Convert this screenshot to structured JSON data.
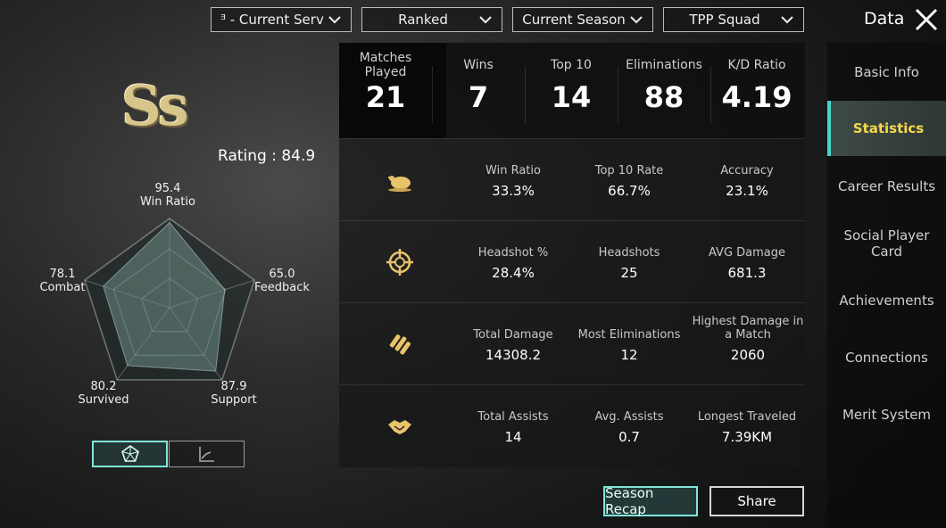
{
  "header": {
    "title": "Data",
    "filters": {
      "server": "ᴲ - Current Server",
      "mode": "Ranked",
      "season": "Current Season",
      "squad": "TPP Squad"
    }
  },
  "sidebar": {
    "items": [
      {
        "label": "Basic Info"
      },
      {
        "label": "Statistics"
      },
      {
        "label": "Career Results"
      },
      {
        "label": "Social Player Card"
      },
      {
        "label": "Achievements"
      },
      {
        "label": "Connections"
      },
      {
        "label": "Merit System"
      }
    ],
    "active": "Statistics"
  },
  "profile": {
    "rank_emblem": "Ss",
    "rating_label": "Rating : 84.9",
    "radar": {
      "win_ratio": {
        "value": "95.4",
        "label": "Win Ratio",
        "score": 95.4
      },
      "feedback": {
        "value": "65.0",
        "label": "Feedback",
        "score": 65.0
      },
      "support": {
        "value": "87.9",
        "label": "Support",
        "score": 87.9
      },
      "survived": {
        "value": "80.2",
        "label": "Survived",
        "score": 80.2
      },
      "combat": {
        "value": "78.1",
        "label": "Combat",
        "score": 78.1
      }
    }
  },
  "summary": [
    {
      "label": "Matches Played",
      "value": "21"
    },
    {
      "label": "Wins",
      "value": "7"
    },
    {
      "label": "Top 10",
      "value": "14"
    },
    {
      "label": "Eliminations",
      "value": "88"
    },
    {
      "label": "K/D Ratio",
      "value": "4.19"
    }
  ],
  "rows": [
    {
      "icon": "chicken-dinner-icon",
      "stats": [
        {
          "label": "Win Ratio",
          "value": "33.3%"
        },
        {
          "label": "Top 10 Rate",
          "value": "66.7%"
        },
        {
          "label": "Accuracy",
          "value": "23.1%"
        }
      ]
    },
    {
      "icon": "crosshair-icon",
      "stats": [
        {
          "label": "Headshot %",
          "value": "28.4%"
        },
        {
          "label": "Headshots",
          "value": "25"
        },
        {
          "label": "AVG Damage",
          "value": "681.3"
        }
      ]
    },
    {
      "icon": "ammo-icon",
      "stats": [
        {
          "label": "Total Damage",
          "value": "14308.2"
        },
        {
          "label": "Most Eliminations",
          "value": "12"
        },
        {
          "label": "Highest Damage in a Match",
          "value": "2060"
        }
      ]
    },
    {
      "icon": "handshake-icon",
      "stats": [
        {
          "label": "Total Assists",
          "value": "14"
        },
        {
          "label": "Avg. Assists",
          "value": "0.7"
        },
        {
          "label": "Longest Traveled",
          "value": "7.39KM"
        }
      ]
    }
  ],
  "buttons": {
    "season_recap": "Season Recap",
    "share": "Share"
  },
  "colors": {
    "accent_teal": "#7fe6da",
    "active_tab_text": "#f6d94a",
    "icon_gold": "#e9c36a"
  }
}
